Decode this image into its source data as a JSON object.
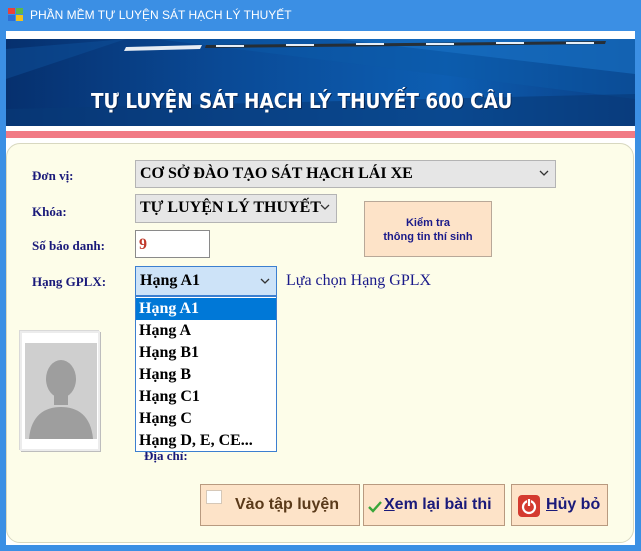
{
  "window": {
    "title": "PHẦN MỀM TỰ LUYỆN SÁT HẠCH LÝ THUYẾT"
  },
  "banner": {
    "title": "TỰ LUYỆN SÁT HẠCH LÝ THUYẾT 600 CÂU"
  },
  "form": {
    "don_vi_label": "Đơn vị:",
    "don_vi_value": "CƠ SỞ ĐÀO TẠO SÁT HẠCH LÁI XE",
    "khoa_label": "Khóa:",
    "khoa_value": "TỰ LUYỆN LÝ THUYẾT",
    "so_bao_danh_label": "Số báo danh:",
    "so_bao_danh_value": "9",
    "hang_label": "Hạng GPLX:",
    "hang_value": "Hạng A1",
    "hang_hint": "Lựa chọn Hạng GPLX",
    "hang_options": [
      "Hạng A1",
      "Hạng A",
      "Hạng B1",
      "Hạng B",
      "Hạng C1",
      "Hạng C",
      "Hạng D, E, CE..."
    ],
    "selected_index": 0,
    "dia_chi_label": "Địa chỉ:"
  },
  "check_button": {
    "line1": "Kiểm tra",
    "line2": "thông tin thí sinh"
  },
  "buttons": {
    "vao_tap_luyen": "Vào tập luyện",
    "xem_lai_underline": "X",
    "xem_lai_rest": "em lại bài thi",
    "huy_underline": "H",
    "huy_rest": "ủy bỏ"
  },
  "colors": {
    "titlebar": "#3b8fe4",
    "panel": "#fdfde9",
    "label": "#1a1a7a",
    "button": "#fde3c8",
    "selected": "#0078d7",
    "accent_bar": "#f17a84"
  }
}
